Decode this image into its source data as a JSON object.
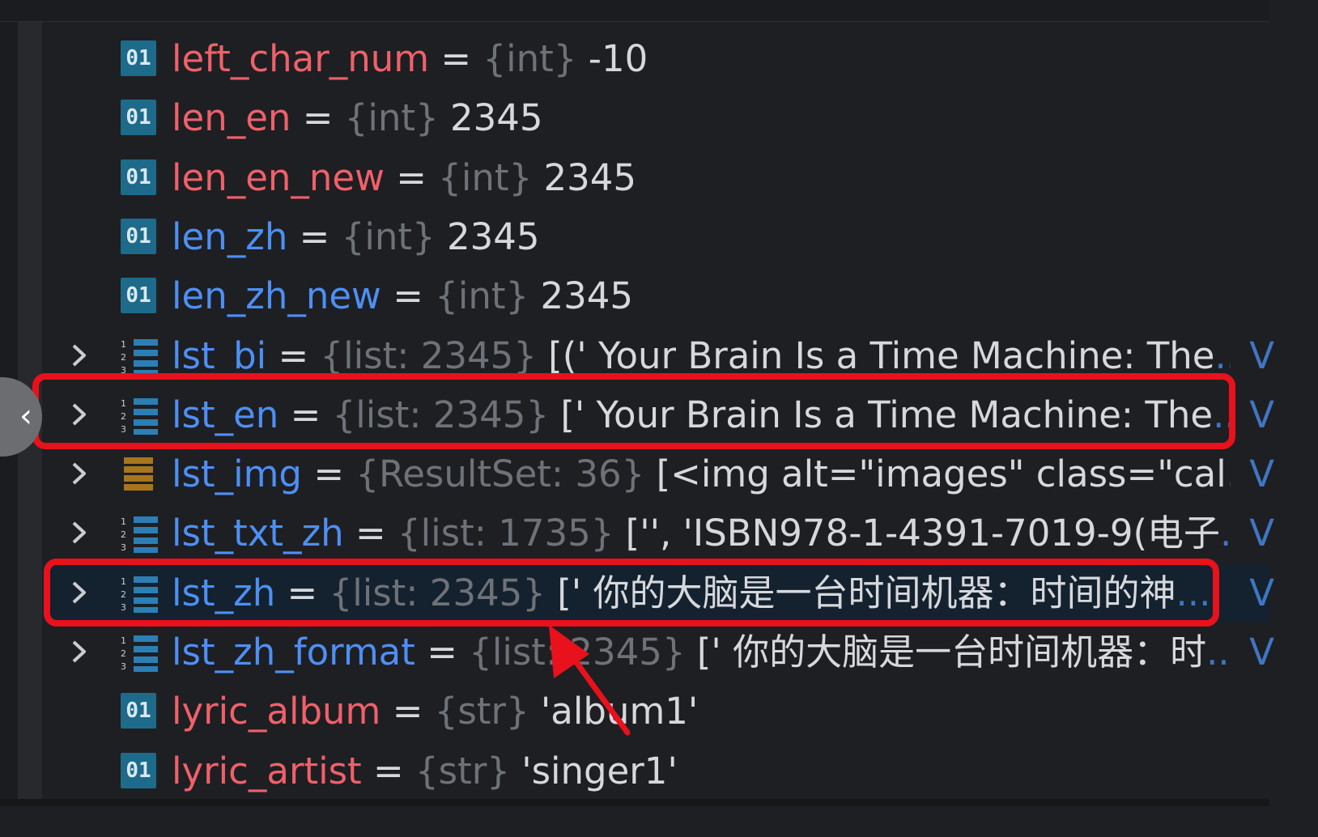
{
  "variables": [
    {
      "name": "left_char_num",
      "type": "{int}",
      "value": "-10",
      "icon": "int-icon",
      "color": "red",
      "expandable": false
    },
    {
      "name": "len_en",
      "type": "{int}",
      "value": "2345",
      "icon": "int-icon",
      "color": "red",
      "expandable": false
    },
    {
      "name": "len_en_new",
      "type": "{int}",
      "value": "2345",
      "icon": "int-icon",
      "color": "red",
      "expandable": false
    },
    {
      "name": "len_zh",
      "type": "{int}",
      "value": "2345",
      "icon": "int-icon",
      "color": "blue",
      "expandable": false
    },
    {
      "name": "len_zh_new",
      "type": "{int}",
      "value": "2345",
      "icon": "int-icon",
      "color": "blue",
      "expandable": false
    },
    {
      "name": "lst_bi",
      "type": "{list: 2345}",
      "value": "[(' Your Brain Is a Time Machine: The",
      "ellipsis": "...",
      "view": "V",
      "icon": "list-icon",
      "color": "blue",
      "expandable": true
    },
    {
      "name": "lst_en",
      "type": "{list: 2345}",
      "value": "[' Your Brain Is a Time Machine: The",
      "ellipsis": "...",
      "view": "V",
      "icon": "list-icon",
      "color": "blue",
      "expandable": true
    },
    {
      "name": "lst_img",
      "type": "{ResultSet: 36}",
      "value": "[<img alt=\"images\" class=\"cal",
      "ellipsis": "...",
      "view": "V",
      "icon": "resultset-icon",
      "color": "blue",
      "expandable": true
    },
    {
      "name": "lst_txt_zh",
      "type": "{list: 1735}",
      "value": "['', 'ISBN978-1-4391-7019-9(电子",
      "ellipsis": "...",
      "view": "V",
      "icon": "list-icon",
      "color": "blue",
      "expandable": true
    },
    {
      "name": "lst_zh",
      "type": "{list: 2345}",
      "value": "[' 你的大脑是一台时间机器：时间的神",
      "ellipsis": "...",
      "view": "V",
      "icon": "list-icon",
      "color": "blue",
      "expandable": true,
      "selected": true
    },
    {
      "name": "lst_zh_format",
      "type": "{list: 2345}",
      "value": "[' 你的大脑是一台时间机器：时",
      "ellipsis": "...",
      "view": "V",
      "icon": "list-icon",
      "color": "blue",
      "expandable": true
    },
    {
      "name": "lyric_album",
      "type": "{str}",
      "value": "'album1'",
      "icon": "int-icon",
      "color": "red",
      "expandable": false
    },
    {
      "name": "lyric_artist",
      "type": "{str}",
      "value": "'singer1'",
      "icon": "int-icon",
      "color": "red",
      "expandable": false
    }
  ],
  "labels": {
    "eq": "=",
    "int_icon_text": "01",
    "back_glyph": "‹"
  },
  "colors": {
    "name_red": "#f0606a",
    "name_blue": "#4d8ff5",
    "type_gray": "#6e7278",
    "highlight": "#e8111c",
    "selected_row": "#14212e"
  },
  "annotations": {
    "highlighted_rows": [
      "lst_en",
      "lst_zh"
    ],
    "arrow_target": "lst_zh"
  }
}
